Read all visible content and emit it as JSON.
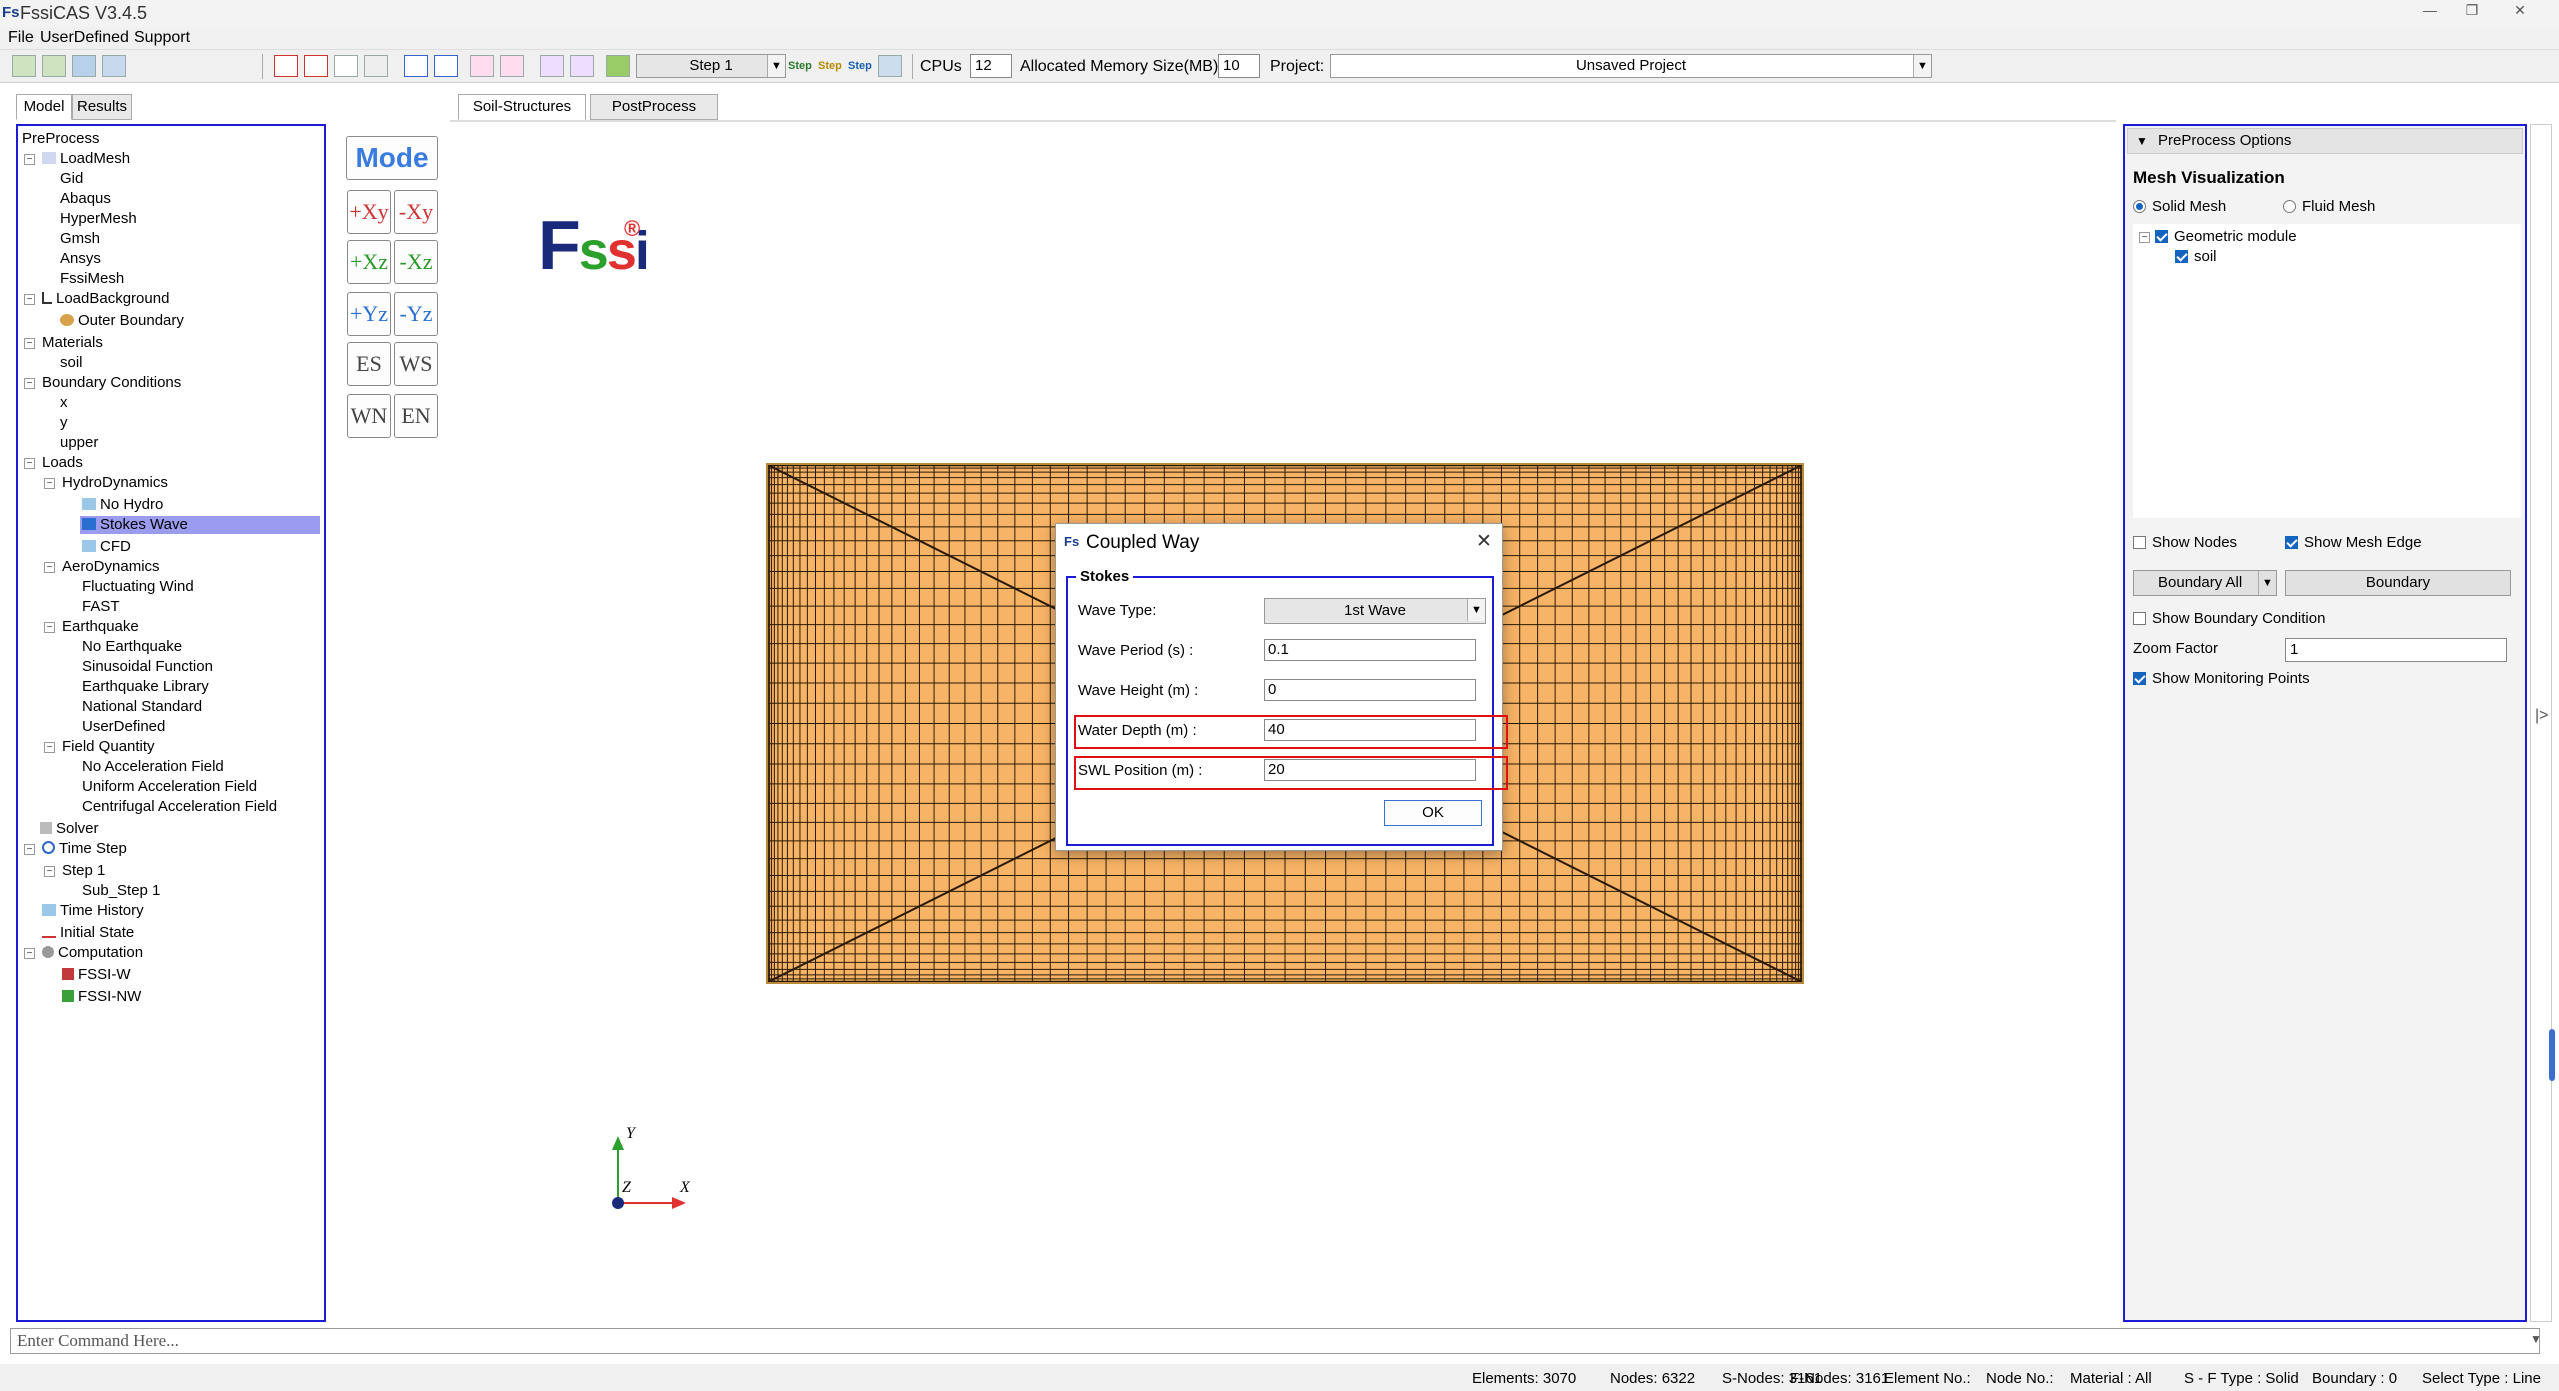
{
  "app": {
    "title": "FssiCAS V3.4.5",
    "logo": "Fs"
  },
  "menu": [
    "File",
    "UserDefined",
    "Support"
  ],
  "toolbar": {
    "step": "Step 1",
    "step_btns": [
      "Step",
      "Step",
      "Step"
    ],
    "cpus_label": "CPUs",
    "cpus_value": "12",
    "memory_label": "Allocated Memory Size(MB) :",
    "memory_value": "10",
    "project_label": "Project:",
    "project_value": "Unsaved Project"
  },
  "left_tabs": [
    "Model",
    "Results"
  ],
  "tree": {
    "preprocess": "PreProcess",
    "loadmesh": "LoadMesh",
    "gid": "Gid",
    "abaqus": "Abaqus",
    "hypermesh": "HyperMesh",
    "gmsh": "Gmsh",
    "ansys": "Ansys",
    "fssimesh": "FssiMesh",
    "loadbackground": "LoadBackground",
    "outer_boundary": "Outer Boundary",
    "materials": "Materials",
    "soil": "soil",
    "boundary_conditions": "Boundary Conditions",
    "x": "x",
    "y": "y",
    "upper": "upper",
    "loads": "Loads",
    "hydrodynamics": "HydroDynamics",
    "no_hydro": "No Hydro",
    "stokes_wave": "Stokes Wave",
    "cfd": "CFD",
    "aerodynamics": "AeroDynamics",
    "fluctuating_wind": "Fluctuating Wind",
    "fast": "FAST",
    "earthquake": "Earthquake",
    "no_earthquake": "No Earthquake",
    "sinusoidal": "Sinusoidal Function",
    "eq_library": "Earthquake Library",
    "national_standard": "National Standard",
    "userdefined": "UserDefined",
    "field_quantity": "Field Quantity",
    "no_accel": "No Acceleration Field",
    "uniform_accel": "Uniform Acceleration Field",
    "centrifugal_accel": "Centrifugal Acceleration Field",
    "solver": "Solver",
    "time_step": "Time Step",
    "step1": "Step 1",
    "substep1": "Sub_Step 1",
    "time_history": "Time History",
    "initial_state": "Initial State",
    "computation": "Computation",
    "fssi_w": "FSSI-W",
    "fssi_nw": "FSSI-NW"
  },
  "view_tabs": [
    "Soil-Structures",
    "PostProcess"
  ],
  "view_buttons": {
    "mode": "Mode",
    "px_y": "+Xy",
    "mx_y": "-Xy",
    "px_z": "+Xz",
    "mx_z": "-Xz",
    "py_z": "+Yz",
    "my_z": "-Yz",
    "es": "ES",
    "ws": "WS",
    "wn": "WN",
    "en": "EN"
  },
  "brand": {
    "f": "F",
    "s1": "s",
    "s2": "s",
    "i": "i",
    "reg": "®"
  },
  "axes": {
    "y": "Y",
    "z": "Z",
    "x": "X"
  },
  "dialog": {
    "title": "Coupled Way",
    "group": "Stokes",
    "wave_type_label": "Wave Type:",
    "wave_type_value": "1st Wave",
    "wave_period_label": "Wave Period (s) :",
    "wave_period_value": "0.1",
    "wave_height_label": "Wave Height (m) :",
    "wave_height_value": "0",
    "water_depth_label": "Water Depth (m) :",
    "water_depth_value": "40",
    "swl_label": "SWL Position (m) :",
    "swl_value": "20",
    "ok": "OK"
  },
  "right_panel": {
    "header": "PreProcess Options",
    "mesh_vis": "Mesh Visualization",
    "solid_mesh": "Solid Mesh",
    "fluid_mesh": "Fluid Mesh",
    "geo_module": "Geometric module",
    "soil": "soil",
    "show_nodes": "Show Nodes",
    "show_mesh_edge": "Show Mesh Edge",
    "boundary_all": "Boundary All",
    "boundary": "Boundary",
    "show_bc": "Show Boundary Condition",
    "zoom_label": "Zoom Factor",
    "zoom_value": "1",
    "show_monitor": "Show Monitoring Points"
  },
  "command": {
    "placeholder": "Enter Command Here..."
  },
  "status": {
    "elements": "Elements: 3070",
    "nodes": "Nodes: 6322",
    "snodes": "S-Nodes: 3161",
    "fnodes": "F-Nodes: 3161",
    "element_no": "Element No.:",
    "node_no": "Node No.:",
    "material": "Material : All",
    "sf_type": "S - F Type : Solid",
    "boundary": "Boundary : 0",
    "select_type": "Select Type : Line"
  },
  "colors": {
    "accent": "#1c1cd8",
    "mesh": "#f8b466",
    "highlight": "#e01010",
    "selection": "#9b9bf0"
  }
}
